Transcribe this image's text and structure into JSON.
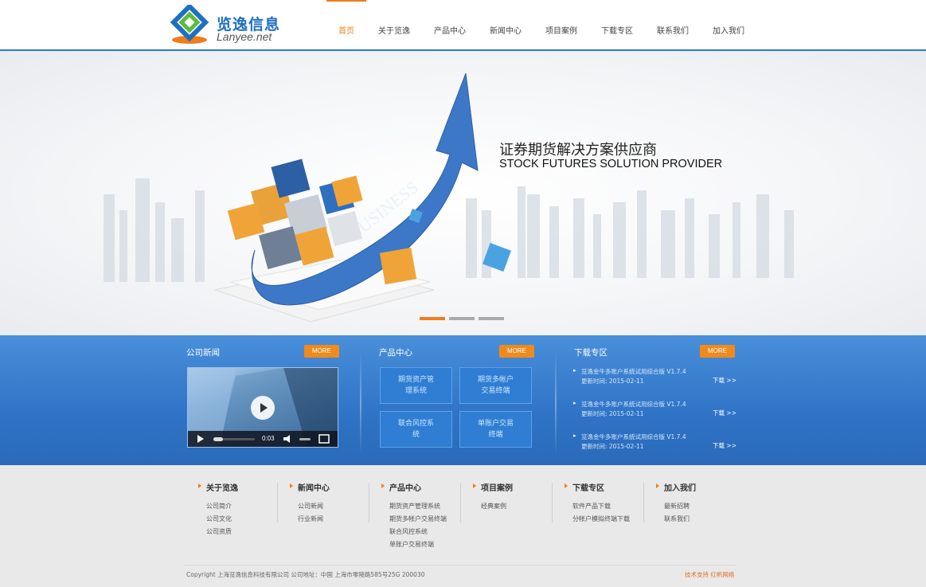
{
  "header": {
    "logo_cn": "览逸信息",
    "logo_en": "Lanyee.net",
    "nav": [
      {
        "label": "首页",
        "active": true
      },
      {
        "label": "关于览逸"
      },
      {
        "label": "产品中心"
      },
      {
        "label": "新闻中心"
      },
      {
        "label": "项目案例"
      },
      {
        "label": "下载专区"
      },
      {
        "label": "联系我们"
      },
      {
        "label": "加入我们"
      }
    ]
  },
  "banner": {
    "title_cn": "证券期货解决方案供应商",
    "title_en": "STOCK FUTURES SOLUTION PROVIDER",
    "arrow_text": "BUSINESS",
    "slides": 3,
    "active_slide": 1
  },
  "news": {
    "title": "公司新闻",
    "more": "MORE",
    "video_time": "0:03"
  },
  "products": {
    "title": "产品中心",
    "more": "MORE",
    "items": [
      "期货资产管理系统",
      "期货多帐户交易终端",
      "联合风控系统",
      "单账户交易终端"
    ]
  },
  "downloads": {
    "title": "下载专区",
    "more": "MORE",
    "items": [
      {
        "name": "览逸金牛多账户系统试用综合版 V1.7.4",
        "date": "更新时间: 2015-02-11",
        "link": "下载 >>"
      },
      {
        "name": "览逸金牛多账户系统试用综合版 V1.7.4",
        "date": "更新时间: 2015-02-11",
        "link": "下载 >>"
      },
      {
        "name": "览逸金牛多账户系统试用综合版 V1.7.4",
        "date": "更新时间: 2015-02-11",
        "link": "下载 >>"
      }
    ]
  },
  "footer": {
    "columns": [
      {
        "title": "关于览逸",
        "links": [
          "公司简介",
          "公司文化",
          "公司资质"
        ]
      },
      {
        "title": "新闻中心",
        "links": [
          "公司新闻",
          "行业新闻"
        ]
      },
      {
        "title": "产品中心",
        "links": [
          "期货资产管理系统",
          "期货多帐户交易终端",
          "联合风控系统",
          "单账户交易终端"
        ]
      },
      {
        "title": "项目案例",
        "links": [
          "经典案例"
        ]
      },
      {
        "title": "下载专区",
        "links": [
          "软件产品下载",
          "分帐户模拟终端下载"
        ]
      },
      {
        "title": "加入我们",
        "links": [
          "最新招聘",
          "联系我们"
        ]
      }
    ],
    "copyright": "Copyright 上海览逸信息科技有限公司 公司地址：中国 上海市零陵路585号25G 200030",
    "support": "技术支持  红帆网络"
  },
  "colors": {
    "accent": "#f07d1a",
    "brand_blue": "#2a7ad2"
  }
}
